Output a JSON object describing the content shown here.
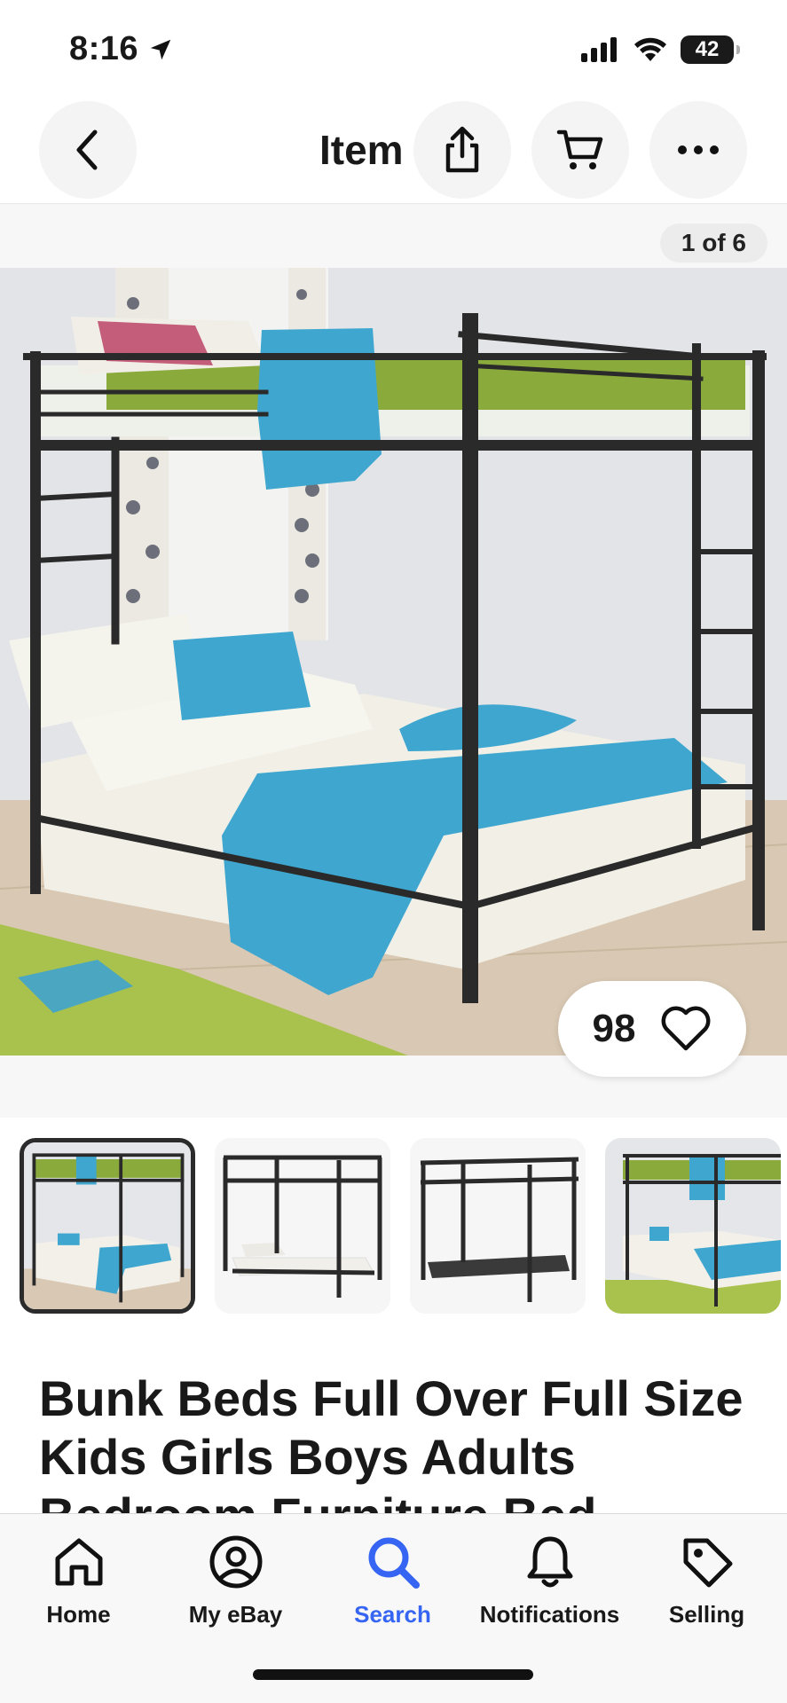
{
  "status_bar": {
    "time": "8:16",
    "battery": "42"
  },
  "nav": {
    "title": "Item"
  },
  "gallery": {
    "counter": "1 of 6",
    "watch_count": "98"
  },
  "title": "Bunk Beds Full Over Full Size Kids Girls Boys Adults Bedroom Furniture Bed",
  "tabs": [
    {
      "label": "Home",
      "icon": "home-icon"
    },
    {
      "label": "My eBay",
      "icon": "profile-icon"
    },
    {
      "label": "Search",
      "icon": "search-icon"
    },
    {
      "label": "Notifications",
      "icon": "bell-icon"
    },
    {
      "label": "Selling",
      "icon": "tag-icon"
    }
  ],
  "colors": {
    "accent": "#3665f3",
    "text": "#191919",
    "bed_frame": "#2a2a2a",
    "blanket": "#3fa7cf",
    "mattress_top": "#8aab3c"
  }
}
